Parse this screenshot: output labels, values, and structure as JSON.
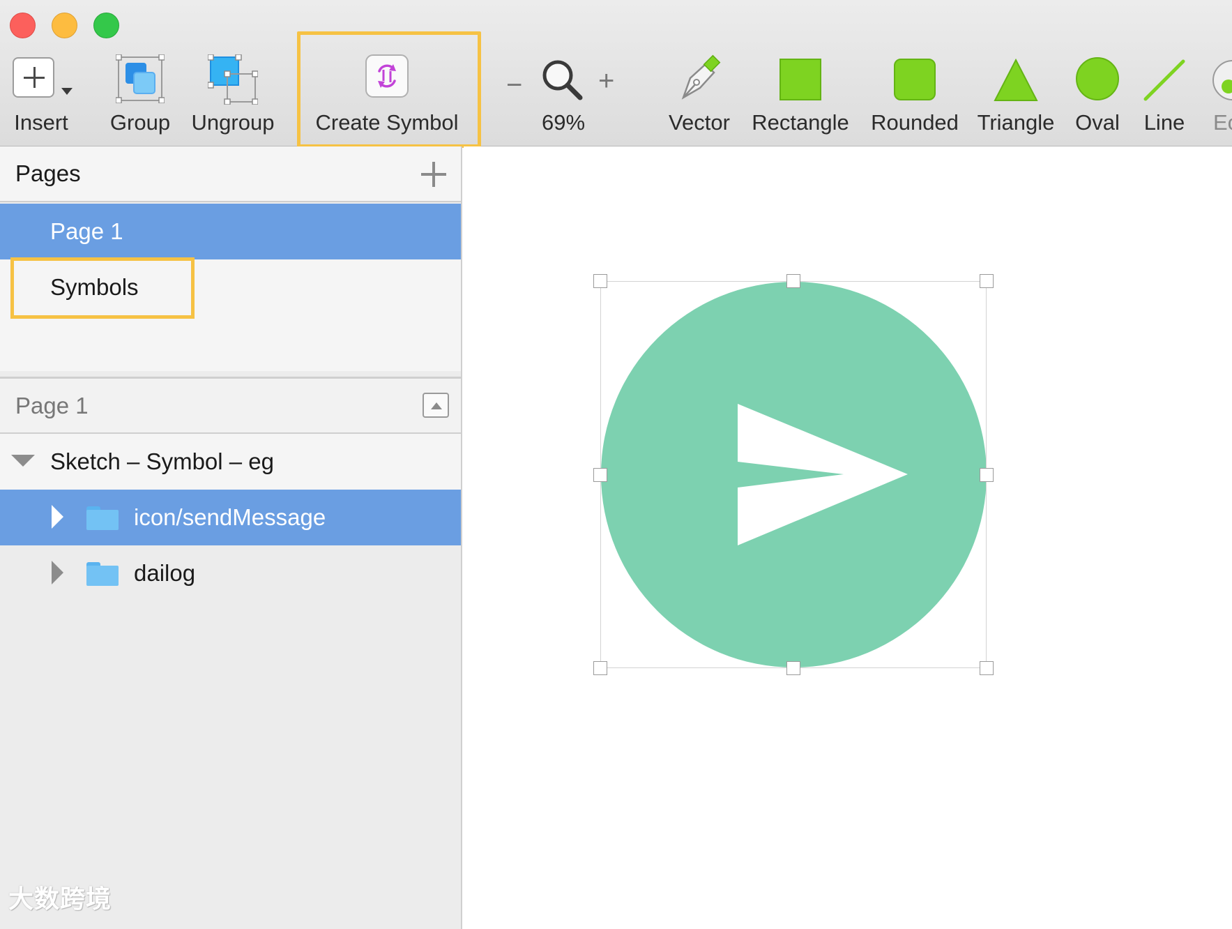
{
  "window": {
    "traffic_lights": [
      "close",
      "minimize",
      "zoom"
    ]
  },
  "toolbar": {
    "insert_label": "Insert",
    "group_label": "Group",
    "ungroup_label": "Ungroup",
    "create_symbol_label": "Create Symbol",
    "zoom_minus": "−",
    "zoom_plus": "+",
    "zoom_level": "69%",
    "vector_label": "Vector",
    "rectangle_label": "Rectangle",
    "rounded_label": "Rounded",
    "triangle_label": "Triangle",
    "oval_label": "Oval",
    "line_label": "Line",
    "edit_label_partial": "Ec",
    "shape_color": "#7ed321",
    "highlight_color": "#f6c244"
  },
  "sidebar": {
    "pages_title": "Pages",
    "pages": [
      {
        "label": "Page 1",
        "selected": true
      },
      {
        "label": "Symbols",
        "selected": false
      }
    ],
    "layers_page_title": "Page 1",
    "artboard_name": "Sketch – Symbol – eg",
    "layers": [
      {
        "label": "icon/sendMessage",
        "selected": true,
        "icon": "folder-icon"
      },
      {
        "label": "dailog",
        "selected": false,
        "icon": "folder-icon"
      }
    ],
    "selection_color": "#6a9ee2",
    "watermark": "大数跨境"
  },
  "canvas": {
    "icon": "send-message-icon",
    "circle_color": "#7dd1b0"
  }
}
